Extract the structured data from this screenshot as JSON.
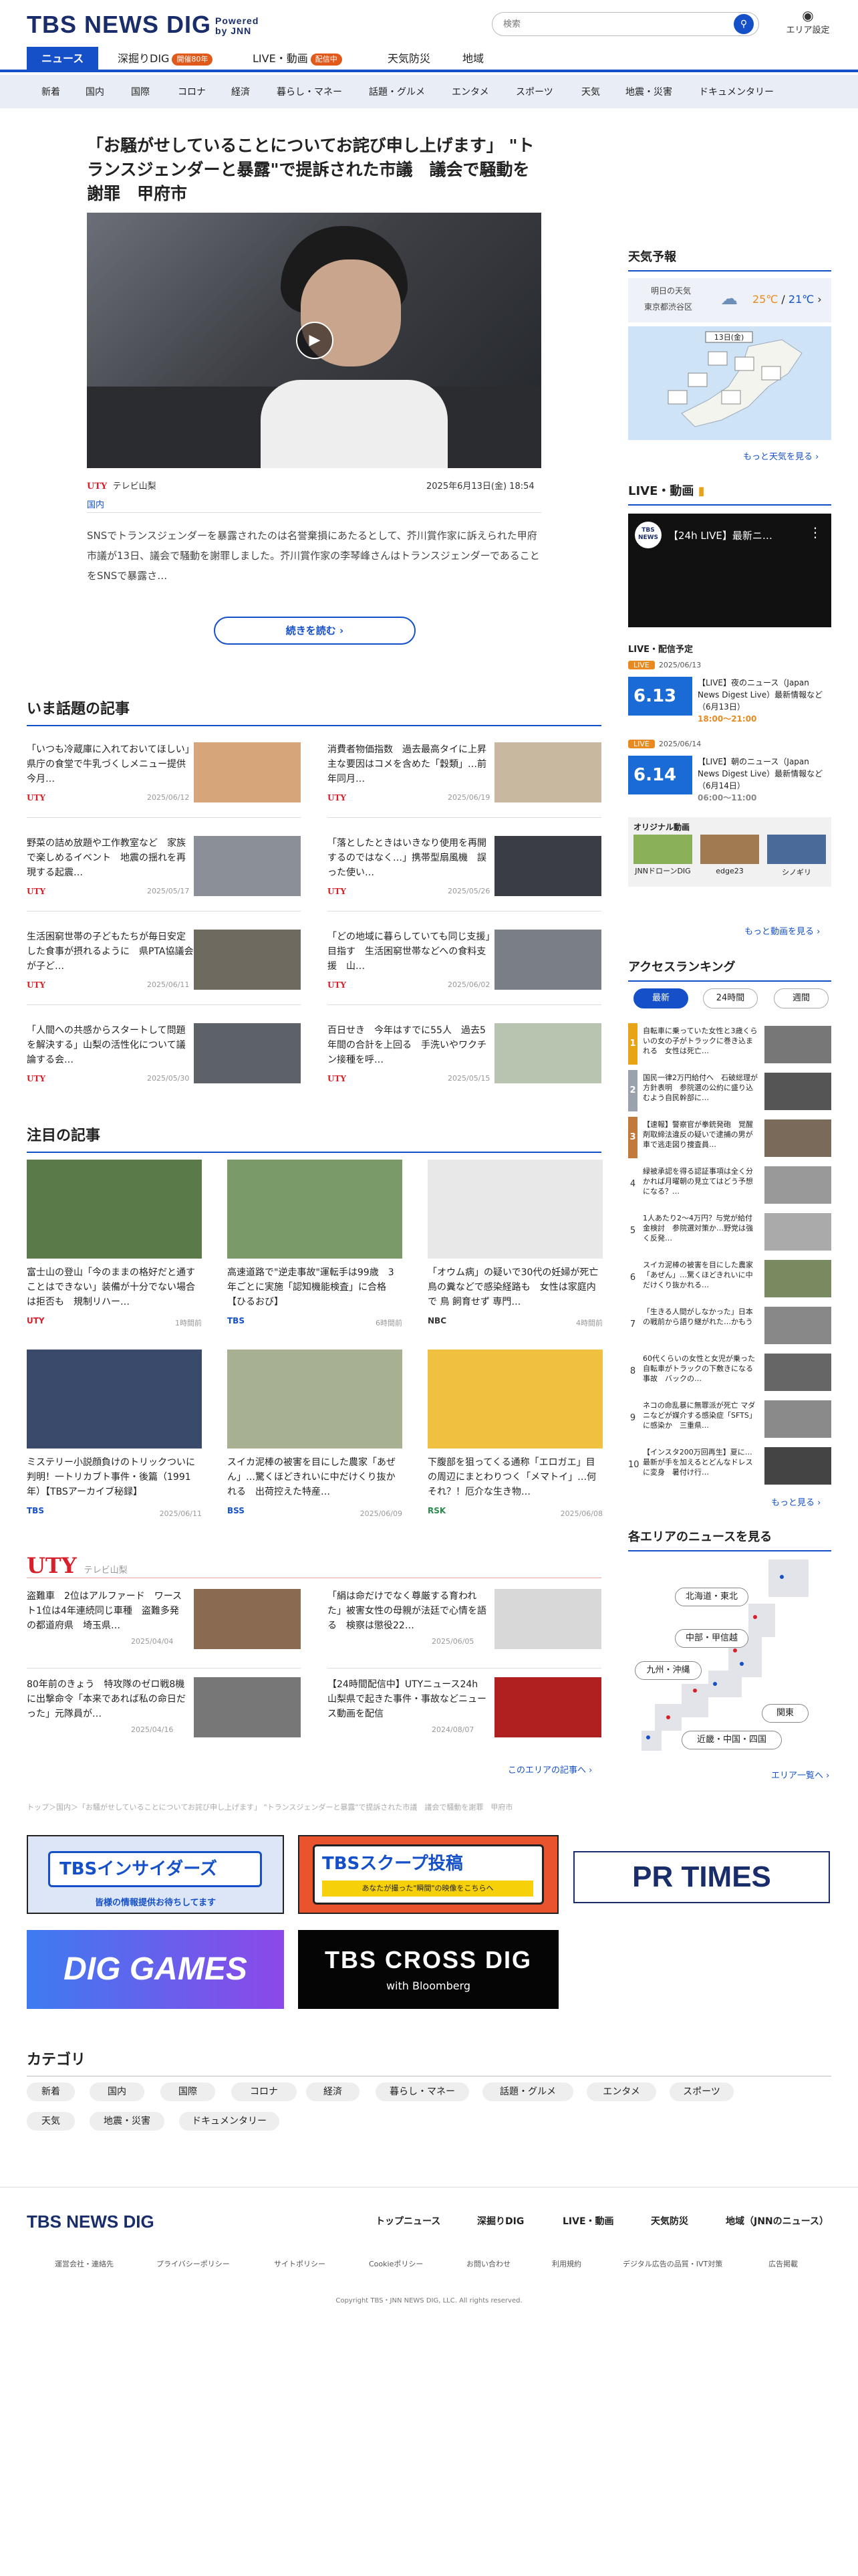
{
  "header": {
    "logo": "TBS NEWS DIG",
    "powered": "Powered",
    "by": "by JNN",
    "search_placeholder": "検索",
    "area_label": "エリア設定"
  },
  "nav_main": {
    "news": "ニュース",
    "fukabori": "深掘りDIG",
    "fukabori_badge": "開催80年",
    "live": "LIVE・動画",
    "live_badge": "配信中",
    "weather": "天気防災",
    "area": "地域"
  },
  "nav_sub": [
    "新着",
    "国内",
    "国際",
    "コロナ",
    "経済",
    "暮らし・マネー",
    "話題・グルメ",
    "エンタメ",
    "スポーツ",
    "天気",
    "地震・災害",
    "ドキュメンタリー"
  ],
  "lead": {
    "title": "「お騒がせしていることについてお詫び申し上げます」 \"トランスジェンダーと暴露\"で提訴された市議　議会で騒動を謝罪　甲府市",
    "source": "UTY",
    "source_name": "テレビ山梨",
    "category": "国内",
    "datetime": "2025年6月13日(金) 18:54",
    "body": "SNSでトランスジェンダーを暴露されたのは名誉棄損にあたるとして、芥川賞作家に訴えられた甲府市議が13日、議会で騒動を謝罪しました。芥川賞作家の李琴峰さんはトランスジェンダーであることをSNSで暴露さ…",
    "read_more": "続きを読む"
  },
  "trending": {
    "title": "いま話題の記事",
    "items": [
      {
        "text": "「いつも冷蔵庫に入れておいてほしい」県庁の食堂で牛乳づくしメニュー提供　今月…",
        "source": "UTY",
        "date": "2025/06/12",
        "color": "#d6a57a"
      },
      {
        "text": "消費者物価指数　過去最高タイに上昇　主な要因はコメを含めた「穀類」…前年同月…",
        "source": "UTY",
        "date": "2025/06/19",
        "color": "#c9b8a0"
      },
      {
        "text": "野菜の詰め放題や工作教室など　家族で楽しめるイベント　地震の揺れを再現する起震…",
        "source": "UTY",
        "date": "2025/05/17",
        "color": "#8a8f98"
      },
      {
        "text": "「落としたときはいきなり使用を再開するのではなく…」携帯型扇風機　誤った使い…",
        "source": "UTY",
        "date": "2025/05/26",
        "color": "#3a3d44"
      },
      {
        "text": "生活困窮世帯の子どもたちが毎日安定した食事が摂れるように　県PTA協議会が子ど…",
        "source": "UTY",
        "date": "2025/06/11",
        "color": "#6f6a60"
      },
      {
        "text": "「どの地域に暮らしていても同じ支援」目指す　生活困窮世帯などへの食料支援　山…",
        "source": "UTY",
        "date": "2025/06/02",
        "color": "#7a7f85"
      },
      {
        "text": "「人間への共感からスタートして問題を解決する」山梨の活性化について議論する会…",
        "source": "UTY",
        "date": "2025/05/30",
        "color": "#5d6168"
      },
      {
        "text": "百日せき　今年はすでに55人　過去5年間の合計を上回る　手洗いやワクチン接種を呼…",
        "source": "UTY",
        "date": "2025/05/15",
        "color": "#b8c4b0"
      }
    ]
  },
  "picks": {
    "title": "注目の記事",
    "items": [
      {
        "text": "富士山の登山「今のままの格好だと通すことはできない」装備が十分でない場合は拒否も　規制リハー…",
        "source": "UTY",
        "date": "1時間前",
        "color": "#d8202a",
        "img": "#5b7a4a"
      },
      {
        "text": "高速道路で\"逆走事故\"運転手は99歳　3年ごとに実施「認知機能検査」に合格【ひるおび】",
        "source": "TBS",
        "date": "6時間前",
        "color": "#1550c8",
        "img": "#7a9a6a"
      },
      {
        "text": "「オウム病」の疑いで30代の妊婦が死亡　鳥の糞などで感染経路も　女性は家庭内で 鳥 飼育せず 専門…",
        "source": "NBC",
        "date": "4時間前",
        "color": "#333",
        "img": "#e8e8e8"
      },
      {
        "text": "ミステリー小説顔負けのトリックついに判明！一トリカブト事件・後篇（1991年）【TBSアーカイブ秘録】",
        "source": "TBS",
        "date": "2025/06/11",
        "color": "#1550c8",
        "img": "#3a4a6a"
      },
      {
        "text": "スイカ泥棒の被害を目にした農家「あぜん」…驚くほどきれいに中だけくり抜かれる　出荷控えた特産…",
        "source": "BSS",
        "date": "2025/06/09",
        "color": "#1550c8",
        "img": "#a7b090"
      },
      {
        "text": "下腹部を狙ってくる通称「エロガエ」目の周辺にまとわりつく「メマトイ」…何それ？！厄介な生き物…",
        "source": "RSK",
        "date": "2025/06/08",
        "color": "#2a8a4a",
        "img": "#f0c040"
      }
    ]
  },
  "uty": {
    "logo": "UTY",
    "name": "テレビ山梨",
    "items": [
      {
        "text": "盗難車　2位はアルファード　ワースト1位は4年連続同じ車種　盗難多発の都道府県　埼玉県…",
        "date": "2025/04/04",
        "color": "#8a6a50"
      },
      {
        "text": "「絹は命だけでなく尊厳する育われた」被害女性の母親が法廷で心情を語る　検察は懲役22…",
        "date": "2025/06/05",
        "color": "#d8d8d8"
      },
      {
        "text": "80年前のきょう　特攻隊のゼロ戦8機に出撃命令「本来であれば私の命日だった」元隊員が…",
        "date": "2025/04/16",
        "color": "#777"
      },
      {
        "text": "【24時間配信中】UTYニュース24h　山梨県で起きた事件・事故などニュース動画を配信",
        "date": "2024/08/07",
        "color": "#b02020"
      }
    ],
    "more": "このエリアの記事へ"
  },
  "breadcrumb": "トップ＞国内＞「お騒がせしていることについてお詫び申し上げます」 \"トランスジェンダーと暴露\"で提訴された市議　議会で騒動を謝罪　甲府市",
  "banners": {
    "insiders": "TBSインサイダーズ",
    "insiders_sub": "皆様の情報提供お待ちしてます",
    "scoop": "TBSスクープ投稿",
    "scoop_sub": "あなたが撮った\"瞬間\"の映像をこちらへ",
    "prtimes": "PR TIMES",
    "digames": "DIG GAMES",
    "crossdig": "TBS CROSS DIG",
    "crossdig_sub": "with Bloomberg"
  },
  "categories": {
    "title": "カテゴリ",
    "items": [
      "新着",
      "国内",
      "国際",
      "コロナ",
      "経済",
      "暮らし・マネー",
      "話題・グルメ",
      "エンタメ",
      "スポーツ",
      "天気",
      "地震・災害",
      "ドキュメンタリー"
    ]
  },
  "sidebar": {
    "weather_title": "天気予報",
    "weather_when": "明日の天気",
    "weather_where": "東京都渋谷区",
    "weather_hi": "25℃",
    "weather_lo": "21℃",
    "weather_map_date": "13日(金)",
    "weather_more": "もっと天気を見る",
    "live_title": "LIVE・動画",
    "live_video": "【24h LIVE】最新ニ…",
    "sched_title": "LIVE・配信予定",
    "sched": [
      {
        "tag": "LIVE",
        "date": "2025/06/13",
        "big": "6.13",
        "text": "【LIVE】夜のニュース（Japan News Digest Live）最新情報など（6月13日）",
        "time": "18:00～21:00"
      },
      {
        "tag": "LIVE",
        "date": "2025/06/14",
        "big": "6.14",
        "text": "【LIVE】朝のニュース（Japan News Digest Live）最新情報など（6月14日）",
        "time": "06:00～11:00"
      }
    ],
    "orig_title": "オリジナル動画",
    "orig": [
      "JNNドローンDIG",
      "edge23",
      "シノギリ"
    ],
    "video_more": "もっと動画を見る",
    "rank_title": "アクセスランキング",
    "rank_tabs": [
      "最新",
      "24時間",
      "週間"
    ],
    "ranks": [
      {
        "n": "1",
        "text": "自転車に乗っていた女性と3歳くらいの女の子がトラックに巻き込まれる　女性は死亡…",
        "color": "#777"
      },
      {
        "n": "2",
        "text": "国民一律2万円給付へ　石破総理が方針表明　参院選の公約に盛り込むよう自民幹部に…",
        "color": "#555"
      },
      {
        "n": "3",
        "text": "【速報】警察官が拳銃発砲　覚醒剤取締法違反の疑いで逮捕の男が車で逃走図り捜査員…",
        "color": "#7a6a5a"
      },
      {
        "n": "4",
        "text": "緑被承認を得る認証事項は全く分かれば月曜朝の見立てはどう予想になる？…",
        "color": "#999"
      },
      {
        "n": "5",
        "text": "1人あたり2～4万円？与党が給付金検討　参院選対策か…野党は強く反発…",
        "color": "#aaa"
      },
      {
        "n": "6",
        "text": "スイカ泥棒の被害を目にした農家「あぜん」…驚くほどきれいに中だけくり抜かれる…",
        "color": "#7a8a60"
      },
      {
        "n": "7",
        "text": "「生きる人間がしなかった」日本の戦前から語り継がれた…かもう",
        "color": "#888"
      },
      {
        "n": "8",
        "text": "60代くらいの女性と女児が乗った自転車がトラックの下敷きになる事故　バックの…",
        "color": "#666"
      },
      {
        "n": "9",
        "text": "ネコの命乱暴に無罪派が死亡 マダニなどが媒介する感染症「SFTS」に感染か　三重県…",
        "color": "#8a8a8a"
      },
      {
        "n": "10",
        "text": "【インスタ200万回再生】夏に…最新が手を加えるとどんなドレスに変身　暑付け行…",
        "color": "#444"
      }
    ],
    "rank_more": "もっと見る",
    "area_title": "各エリアのニュースを見る",
    "areas": [
      "北海道・東北",
      "中部・甲信越",
      "九州・沖縄",
      "関東",
      "近畿・中国・四国"
    ],
    "area_more": "エリア一覧へ"
  },
  "footer": {
    "logo": "TBS NEWS DIG",
    "nav": [
      "トップニュース",
      "深掘りDIG",
      "LIVE・動画",
      "天気防災",
      "地域（JNNのニュース）"
    ],
    "policy": [
      "運営会社・連絡先",
      "プライバシーポリシー",
      "サイトポリシー",
      "Cookieポリシー",
      "お問い合わせ",
      "利用規約",
      "デジタル広告の品質・IVT対策",
      "広告掲載"
    ],
    "copyright": "Copyright TBS・JNN NEWS DIG, LLC. All rights reserved."
  }
}
